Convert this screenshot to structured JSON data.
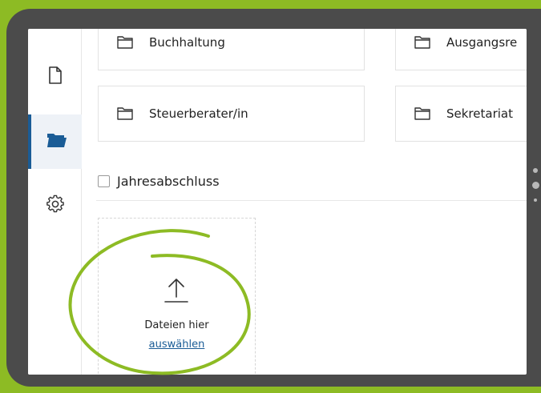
{
  "sidebar": {
    "items": [
      {
        "icon": "document-icon"
      },
      {
        "icon": "folder-icon",
        "active": true
      },
      {
        "icon": "gear-icon"
      }
    ]
  },
  "folders": [
    {
      "label": "Buchhaltung"
    },
    {
      "label": "Ausgangsre"
    },
    {
      "label": "Steuerberater/in"
    },
    {
      "label": "Sekretariat"
    }
  ],
  "section": {
    "label": "Jahresabschluss"
  },
  "upload": {
    "text": "Dateien hier",
    "link": "auswählen",
    "icon": "upload-arrow-icon"
  },
  "colors": {
    "background": "#8dbb24",
    "frame": "#4b4b4b",
    "accent": "#1a5c96",
    "highlight_circle": "#8dbb24"
  }
}
